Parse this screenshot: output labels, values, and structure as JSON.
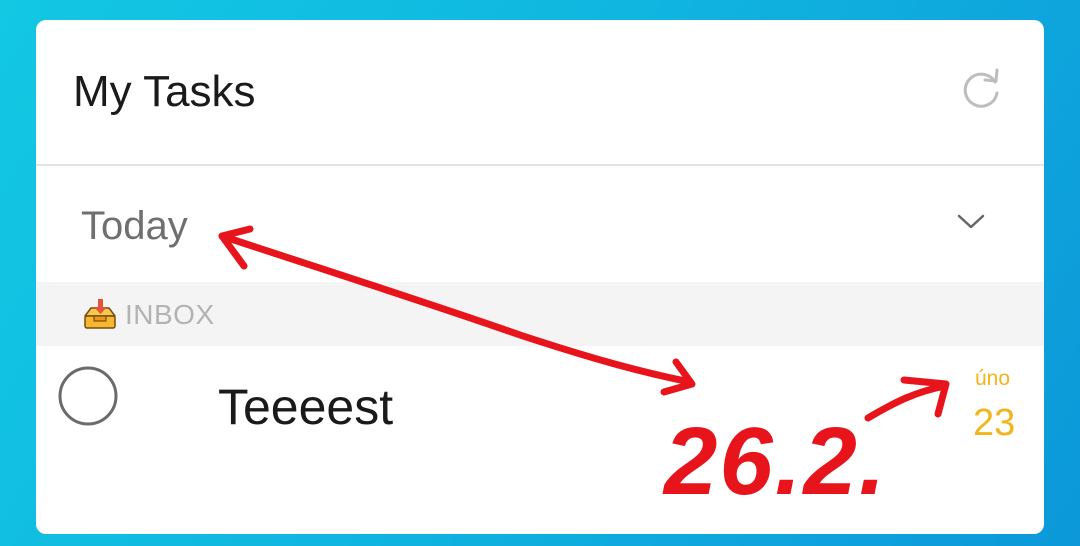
{
  "header": {
    "title": "My Tasks",
    "refresh_icon": "refresh-icon"
  },
  "section": {
    "label": "Today",
    "toggle_icon": "chevron-down-icon"
  },
  "group": {
    "icon": "inbox-tray-icon",
    "label": "INBOX"
  },
  "tasks": [
    {
      "title": "Teeeest",
      "due_label": "úno",
      "due_day": "23"
    }
  ],
  "annotation": {
    "handwritten_text": "26.2.",
    "color": "#e8141c"
  },
  "colors": {
    "accent": "#f2b51b",
    "background_gradient_start": "#12c8e3",
    "background_gradient_end": "#0c98d9"
  }
}
